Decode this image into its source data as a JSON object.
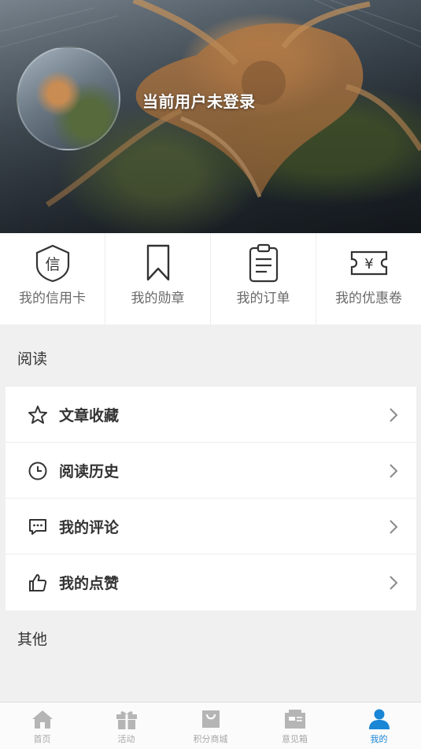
{
  "header": {
    "user_status": "当前用户未登录"
  },
  "quick_actions": [
    {
      "label": "我的信用卡",
      "icon": "credit-card-shield-icon",
      "glyph": "信"
    },
    {
      "label": "我的勋章",
      "icon": "bookmark-medal-icon"
    },
    {
      "label": "我的订单",
      "icon": "clipboard-order-icon"
    },
    {
      "label": "我的优惠卷",
      "icon": "coupon-ticket-icon",
      "glyph": "¥"
    }
  ],
  "reading_section": {
    "title": "阅读",
    "items": [
      {
        "label": "文章收藏",
        "icon": "star-icon"
      },
      {
        "label": "阅读历史",
        "icon": "clock-icon"
      },
      {
        "label": "我的评论",
        "icon": "comment-icon"
      },
      {
        "label": "我的点赞",
        "icon": "thumbs-up-icon"
      }
    ]
  },
  "other_section": {
    "title": "其他"
  },
  "tabbar": {
    "active": "我的",
    "tabs": [
      {
        "label": "首页",
        "icon": "home-icon"
      },
      {
        "label": "活动",
        "icon": "gift-icon"
      },
      {
        "label": "积分商城",
        "icon": "shopping-bag-icon"
      },
      {
        "label": "意见箱",
        "icon": "mailbox-icon"
      },
      {
        "label": "我的",
        "icon": "person-icon"
      }
    ]
  },
  "colors": {
    "accent": "#1a86d6",
    "inactive_tab": "#a6a6a6",
    "background": "#f0f0f0"
  }
}
